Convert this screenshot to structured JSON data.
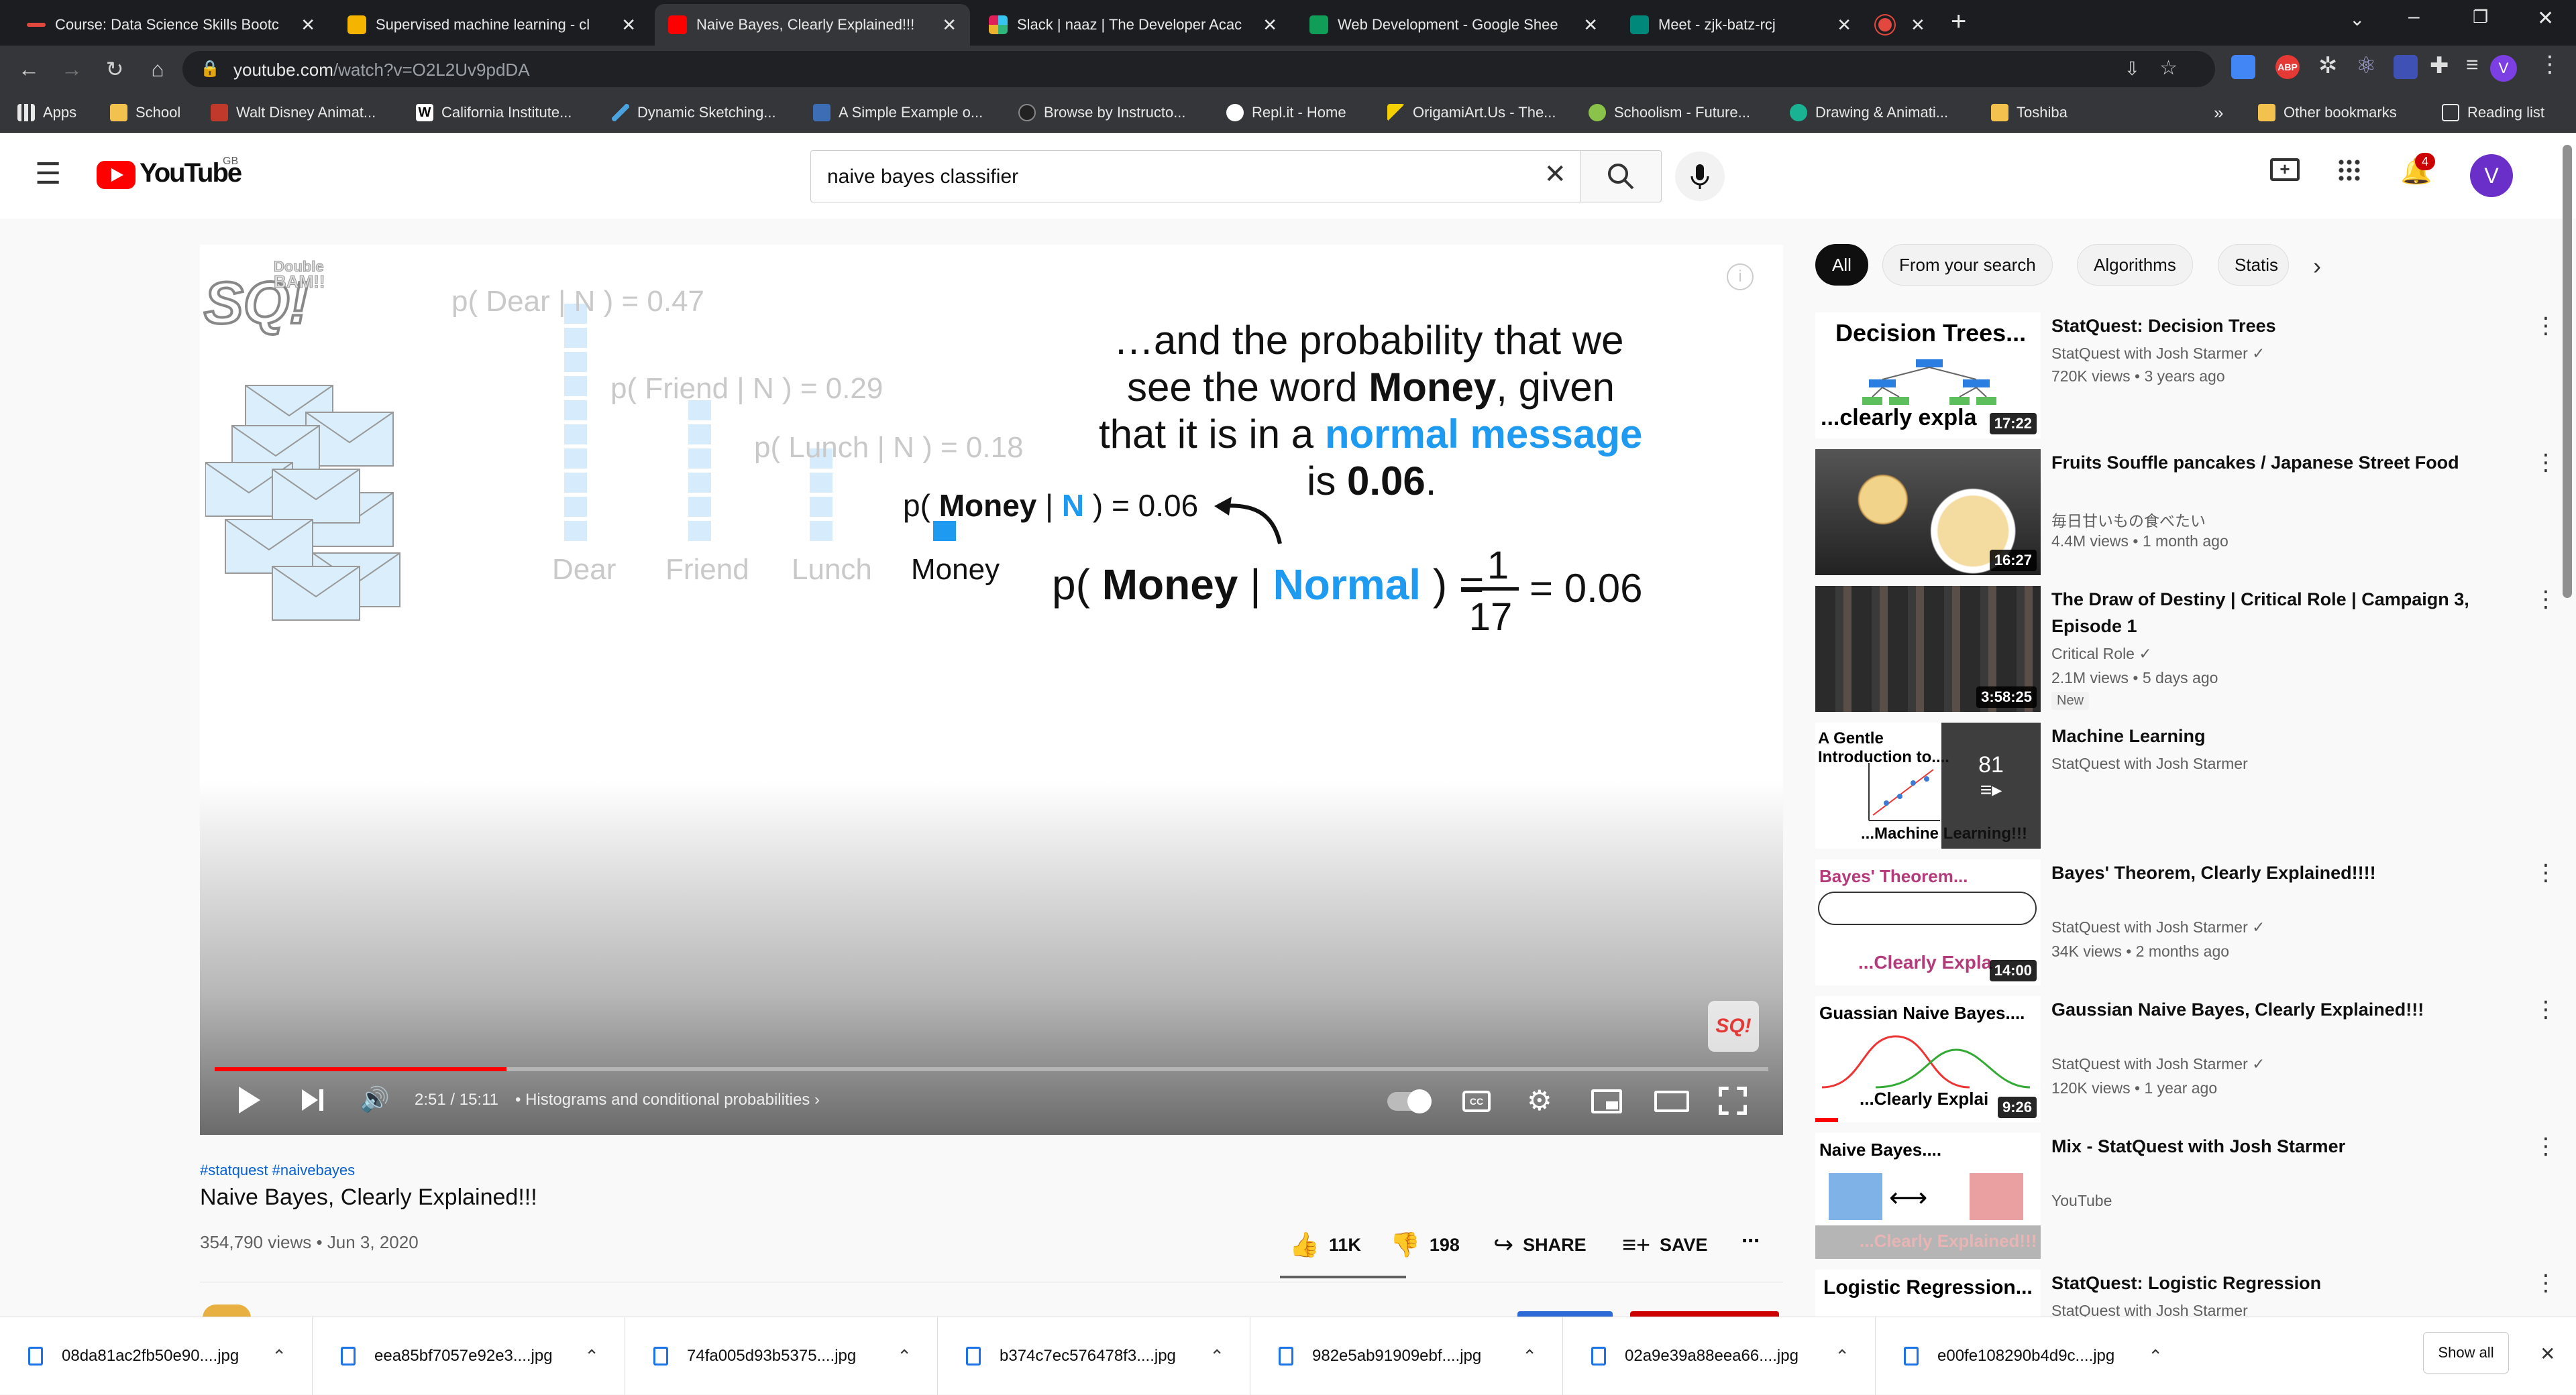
{
  "browser": {
    "tabs": [
      {
        "title": "Course: Data Science Skills Bootc",
        "color": "#e2483d"
      },
      {
        "title": "Supervised machine learning - cl",
        "color": "#f5b400"
      },
      {
        "title": "Naive Bayes, Clearly Explained!!!",
        "color": "#ff0000",
        "active": true
      },
      {
        "title": "Slack | naaz | The Developer Acac",
        "color": "#4a154b"
      },
      {
        "title": "Web Development - Google Shee",
        "color": "#0f9d58"
      },
      {
        "title": "Meet - zjk-batz-rcj",
        "color": "#00897b"
      },
      {
        "title": "",
        "color": "#e2483d"
      }
    ],
    "url_host": "youtube.com",
    "url_path": "/watch?v=O2L2Uv9pdDA",
    "bookmarks": [
      {
        "label": "Apps",
        "icon": "apps-icon"
      },
      {
        "label": "School",
        "icon": "folder-icon"
      },
      {
        "label": "Walt Disney Animat...",
        "icon": "disney-icon"
      },
      {
        "label": "California Institute...",
        "icon": "w-icon"
      },
      {
        "label": "Dynamic Sketching...",
        "icon": "pen-icon"
      },
      {
        "label": "A Simple Example o...",
        "icon": "page-icon"
      },
      {
        "label": "Browse by Instructo...",
        "icon": "globe-icon"
      },
      {
        "label": "Repl.it - Home",
        "icon": "replit-icon"
      },
      {
        "label": "OrigamiArt.Us - The...",
        "icon": "origami-icon"
      },
      {
        "label": "Schoolism - Future...",
        "icon": "schoolism-icon"
      },
      {
        "label": "Drawing & Animati...",
        "icon": "shield-icon"
      },
      {
        "label": "Toshiba",
        "icon": "folder-icon"
      },
      {
        "label": "Other bookmarks",
        "icon": "folder-icon"
      },
      {
        "label": "Reading list",
        "icon": "reading-list-icon"
      }
    ]
  },
  "youtube": {
    "logo": "YouTube",
    "region": "GB",
    "search_query": "naive bayes classifier",
    "notif_count": "4",
    "avatar": "V"
  },
  "video": {
    "slide": {
      "dear_label": "p( Dear | N ) = 0.47",
      "friend_label": "p( Friend | N ) = 0.29",
      "lunch_label": "p( Lunch | N ) = 0.18",
      "money_label_pre": "p( ",
      "money_word": "Money",
      "money_label_mid": " | ",
      "money_n": "N",
      "money_label_post": " ) = 0.06",
      "axis": [
        "Dear",
        "Friend",
        "Lunch",
        "Money"
      ],
      "caption_1": "…and the probability that we",
      "caption_2a": "see the word ",
      "caption_2b": "Money",
      "caption_2c": ", given",
      "caption_3a": "that it is in a ",
      "caption_3b": "normal message",
      "caption_4a": "is ",
      "caption_4b": "0.06",
      "caption_4c": ".",
      "eq_pre": "p( ",
      "eq_money": "Money",
      "eq_bar": " | ",
      "eq_normal": "Normal",
      "eq_post": " ) =",
      "eq_num": "1",
      "eq_den": "17",
      "eq_result": "= 0.06",
      "badge_text": "BAM!!",
      "badge_sub": "Double",
      "logo_text": "SQ!"
    },
    "time": "2:51 / 15:11",
    "chapter": "• Histograms and conditional probabilities",
    "progress_fraction": 0.188,
    "hashtags": "#statquest #naivebayes",
    "title": "Naive Bayes, Clearly Explained!!!",
    "meta": "354,790 views • Jun 3, 2020",
    "likes": "11K",
    "dislikes": "198",
    "share": "SHARE",
    "save": "SAVE"
  },
  "chips": [
    "All",
    "From your search",
    "Algorithms",
    "Statis"
  ],
  "recommendations": [
    {
      "title": "StatQuest: Decision Trees",
      "channel": "StatQuest with Josh Starmer",
      "verified": true,
      "views": "720K views • 3 years ago",
      "duration": "17:22",
      "thumb_top": "Decision Trees...",
      "thumb_bottom": "...clearly expla",
      "thumb_kind": "tree"
    },
    {
      "title": "Fruits Souffle pancakes / Japanese Street Food",
      "channel": "毎日甘いもの食べたい",
      "verified": false,
      "views": "4.4M views • 1 month ago",
      "duration": "16:27",
      "thumb_kind": "pancake"
    },
    {
      "title": "The Draw of Destiny | Critical Role | Campaign 3, Episode 1",
      "channel": "Critical Role",
      "verified": true,
      "views": "2.1M views • 5 days ago",
      "badge": "New",
      "duration": "3:58:25",
      "thumb_kind": "group"
    },
    {
      "title": "Machine Learning",
      "channel": "StatQuest with Josh Starmer",
      "verified": false,
      "views": "",
      "playlist_count": "81",
      "thumb_top": "A Gentle Introduction to....",
      "thumb_bottom": "...Machine Learning!!!",
      "thumb_kind": "playlist"
    },
    {
      "title": "Bayes' Theorem, Clearly Explained!!!!",
      "channel": "StatQuest with Josh Starmer",
      "verified": true,
      "views": "34K views • 2 months ago",
      "duration": "14:00",
      "thumb_top": "Bayes' Theorem...",
      "thumb_bottom": "...Clearly Expla",
      "thumb_kind": "bayes"
    },
    {
      "title": "Gaussian Naive Bayes, Clearly Explained!!!",
      "channel": "StatQuest with Josh Starmer",
      "verified": true,
      "views": "120K views • 1 year ago",
      "duration": "9:26",
      "thumb_top": "Guassian Naive Bayes....",
      "thumb_bottom": "...Clearly Explai",
      "thumb_kind": "gauss"
    },
    {
      "title": "Mix - StatQuest with Josh Starmer",
      "channel": "YouTube",
      "verified": false,
      "views": "",
      "thumb_top": "Naive Bayes....",
      "thumb_bottom": "...Clearly Explained!!!",
      "thumb_kind": "mix"
    },
    {
      "title": "StatQuest: Logistic Regression",
      "channel": "StatQuest with Josh Starmer",
      "verified": true,
      "views": "",
      "thumb_top": "Logistic Regression...",
      "thumb_kind": "logistic"
    }
  ],
  "downloads": [
    "08da81ac2fb50e90....jpg",
    "eea85bf7057e92e3....jpg",
    "74fa005d93b5375....jpg",
    "b374c7ec576478f3....jpg",
    "982e5ab91909ebf....jpg",
    "02a9e39a88eea66....jpg",
    "e00fe108290b4d9c....jpg"
  ],
  "show_all": "Show all",
  "colors": {
    "yt_red": "#ff0000",
    "statquest_blue": "#1e9af0",
    "link_blue": "#065fd4",
    "tab_bg": "#1c1d21",
    "toolbar_bg": "#35363a"
  }
}
